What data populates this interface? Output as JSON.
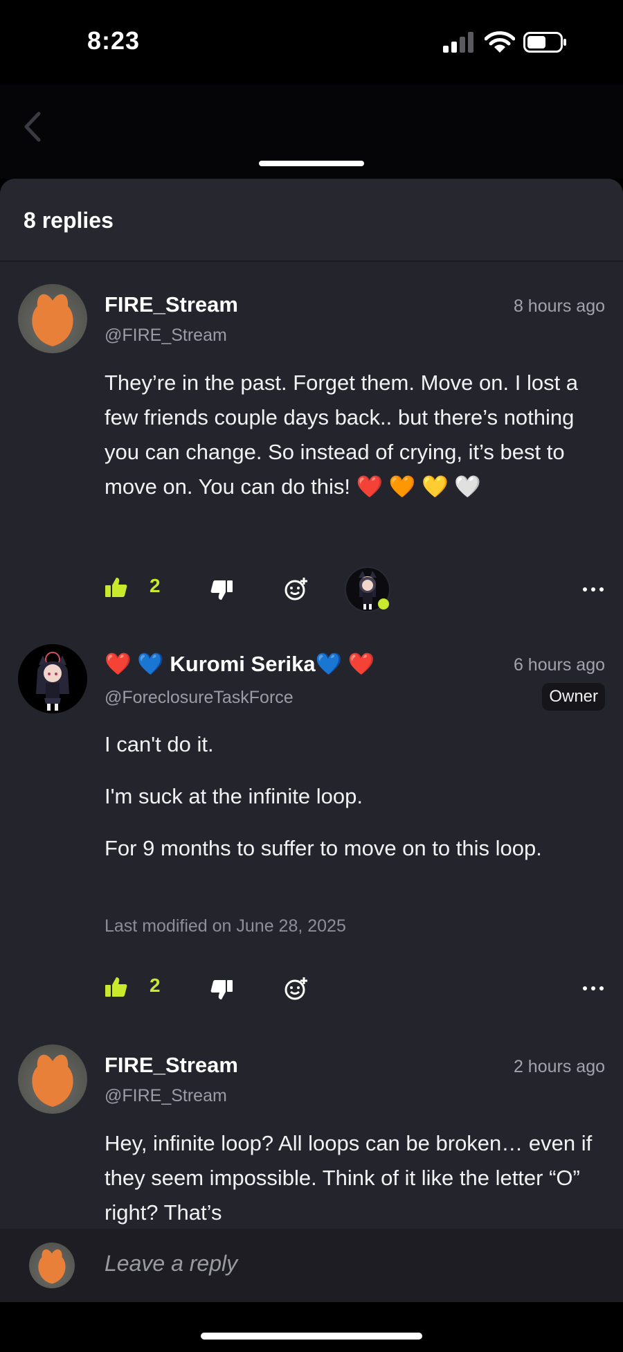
{
  "status_bar": {
    "time": "8:23"
  },
  "sheet": {
    "replies_count": "8 replies"
  },
  "comments": [
    {
      "name": "FIRE_Stream",
      "handle": "@FIRE_Stream",
      "time_ago": "8 hours ago",
      "paragraphs": [
        "They’re in the past. Forget them. Move on. I lost a few friends couple days back.. but there’s nothing you can change. So instead of crying, it’s best to move on. You can do this! ❤️ 🧡 💛 🤍"
      ],
      "likes": "2"
    },
    {
      "name": "❤️ 💙 Kuromi Serika💙 ❤️",
      "handle": "@ForeclosureTaskForce",
      "badge": "Owner",
      "time_ago": "6 hours ago",
      "paragraphs": [
        "I can't do it.",
        "I'm suck at the infinite loop.",
        "For 9 months to suffer to move on to this loop."
      ],
      "modified": "Last modified on June 28, 2025",
      "likes": "2"
    },
    {
      "name": "FIRE_Stream",
      "handle": "@FIRE_Stream",
      "time_ago": "2 hours ago",
      "paragraphs": [
        "Hey, infinite loop? All loops can be broken… even if they seem impossible. Think of it like the letter “O” right? That’s"
      ]
    }
  ],
  "composer": {
    "placeholder": "Leave a reply"
  },
  "colors": {
    "accent": "#c8e92c",
    "sheet_bg": "#24242c",
    "avatar_orange": "#e8803a"
  },
  "icons": [
    "back-chevron-icon",
    "thumbs-up-icon",
    "thumbs-down-icon",
    "add-reaction-icon",
    "more-icon",
    "signal-icon",
    "wifi-icon",
    "battery-icon"
  ]
}
